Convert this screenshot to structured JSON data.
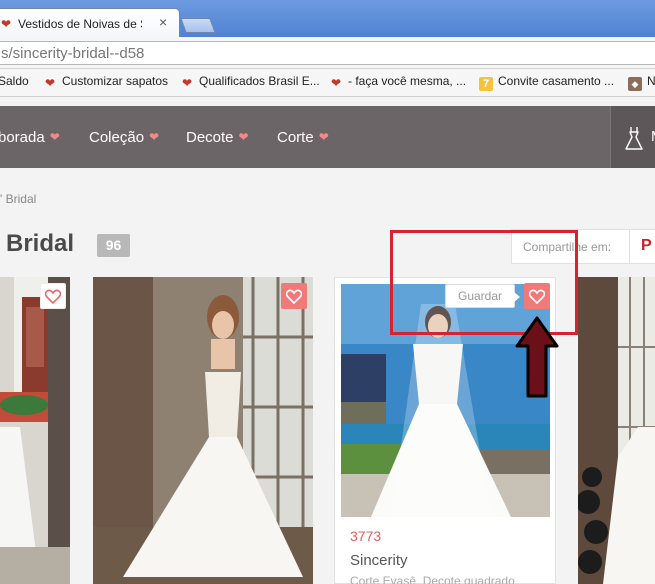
{
  "browser": {
    "tab_title": "Vestidos de Noivas de Sincerity",
    "tab_close": "×",
    "url": "s/sincerity-bridal--d58"
  },
  "bookmarks": [
    {
      "label": "Saldo",
      "icon": "heart-icon"
    },
    {
      "label": "Customizar sapatos",
      "icon": "heart-icon"
    },
    {
      "label": "Qualificados Brasil E...",
      "icon": "heart-icon"
    },
    {
      "label": "- faça você mesma, ...",
      "icon": "heart-icon"
    },
    {
      "label": "Convite casamento ...",
      "icon": "seven-icon",
      "glyph": "7"
    },
    {
      "label": "N",
      "icon": "photo-icon"
    }
  ],
  "nav": {
    "items": [
      {
        "label": "borada"
      },
      {
        "label": "Coleção"
      },
      {
        "label": "Decote"
      },
      {
        "label": "Corte"
      }
    ],
    "heart_glyph": "❤",
    "right_label": "M"
  },
  "breadcrumb": "' Bridal",
  "page": {
    "title": "Bridal",
    "count": "96"
  },
  "share": {
    "label": "Compartilhe em:",
    "pinterest_glyph": "P"
  },
  "featured_card": {
    "save_tooltip": "Guardar",
    "code": "3773",
    "brand": "Sincerity",
    "description": "Corte Evasê, Decote quadrado"
  },
  "colors": {
    "nav_bg": "#6b6567",
    "accent_pink": "#f07a7a",
    "code_red": "#e85c5c",
    "annotation_red": "#d6232f",
    "arrow_dark_red": "#6b0f18"
  }
}
